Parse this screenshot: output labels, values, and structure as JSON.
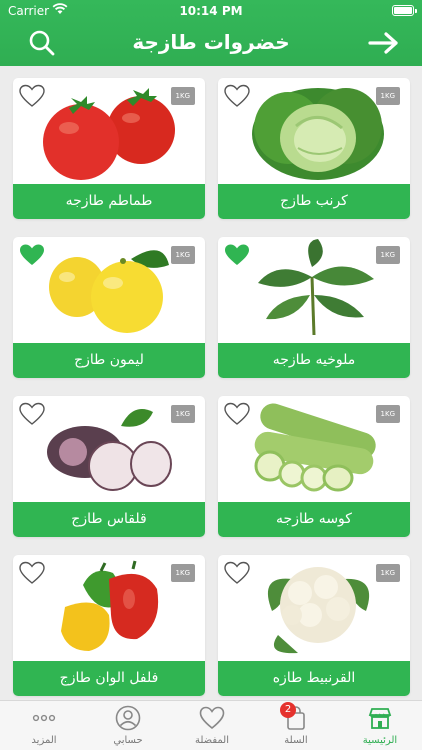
{
  "status_bar": {
    "carrier": "Carrier",
    "time": "10:14 PM"
  },
  "header": {
    "title": "خضروات طازجة"
  },
  "products": [
    {
      "name": "كرنب طازج",
      "weight": "1KG",
      "favorite": false,
      "image": "cabbage"
    },
    {
      "name": "طماطم طازجه",
      "weight": "1KG",
      "favorite": false,
      "image": "tomato"
    },
    {
      "name": "ملوخيه طازجه",
      "weight": "1KG",
      "favorite": true,
      "image": "molokhia"
    },
    {
      "name": "ليمون طازج",
      "weight": "1KG",
      "favorite": true,
      "image": "lemon"
    },
    {
      "name": "كوسه طازجه",
      "weight": "1KG",
      "favorite": false,
      "image": "zucchini"
    },
    {
      "name": "قلقاس طازج",
      "weight": "1KG",
      "favorite": false,
      "image": "taro"
    },
    {
      "name": "القرنبيط طازه",
      "weight": "1KG",
      "favorite": false,
      "image": "cauliflower"
    },
    {
      "name": "فلفل الوان طازج",
      "weight": "1KG",
      "favorite": false,
      "image": "peppers"
    }
  ],
  "tabs": [
    {
      "label": "الرئيسية",
      "icon": "store-icon",
      "active": true
    },
    {
      "label": "السلة",
      "icon": "bag-icon",
      "badge": "2"
    },
    {
      "label": "المفضلة",
      "icon": "heart-icon"
    },
    {
      "label": "حسابي",
      "icon": "user-icon"
    },
    {
      "label": "المزيد",
      "icon": "more-icon"
    }
  ],
  "colors": {
    "primary": "#30b552",
    "favorite": "#30b552",
    "badge": "#e5322d",
    "weight_tag": "#9a9a9a"
  }
}
